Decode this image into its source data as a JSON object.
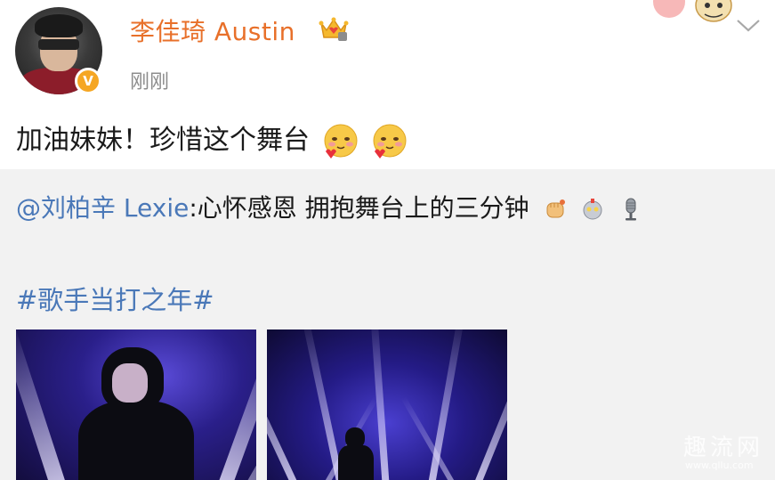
{
  "post": {
    "username": "李佳琦 Austin",
    "timestamp": "刚刚",
    "text": "加油妹妹！珍惜这个舞台",
    "verified_badge": "V",
    "emojis": [
      "blush-heart-emoji",
      "blush-heart-emoji"
    ]
  },
  "repost": {
    "mention": "@刘柏辛 Lexie",
    "separator": ":",
    "text": "心怀感恩 拥抱舞台上的三分钟",
    "emojis": [
      "fist-emoji",
      "robot-emoji",
      "microphone-emoji"
    ],
    "hashtag": "#歌手当打之年#",
    "photo_count": 2
  },
  "watermark": {
    "main": "趣流网",
    "sub": "www.qllu.com"
  },
  "colors": {
    "username": "#e8702a",
    "link": "#4a78b8",
    "repost_bg": "#f2f2f2",
    "timestamp": "#8c8c8c"
  }
}
